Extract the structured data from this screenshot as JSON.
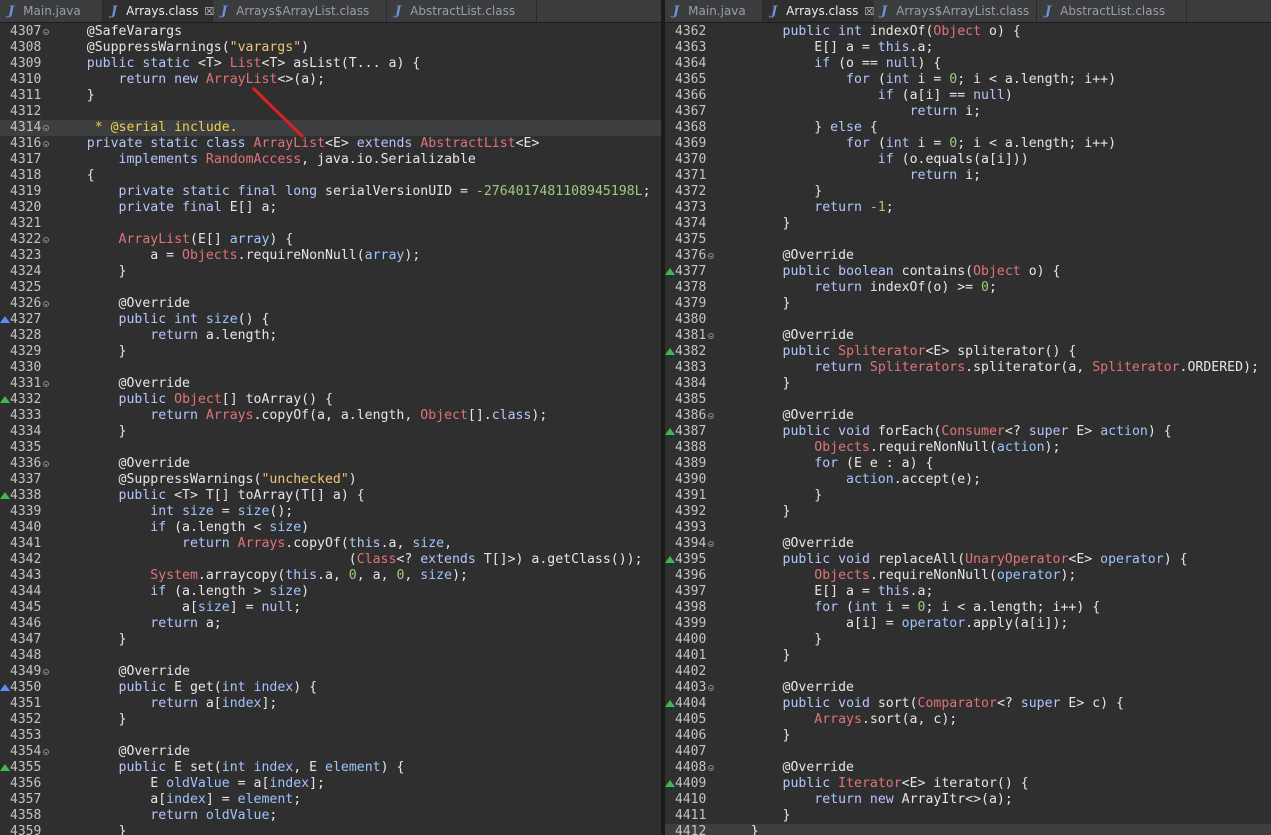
{
  "left_tabs": [
    {
      "label": "Main.java",
      "active": false,
      "closable": false
    },
    {
      "label": "Arrays.class",
      "active": true,
      "closable": true
    },
    {
      "label": "Arrays$ArrayList.class",
      "active": false,
      "closable": false
    },
    {
      "label": "AbstractList.class",
      "active": false,
      "closable": false
    }
  ],
  "right_tabs": [
    {
      "label": "Main.java",
      "active": false,
      "closable": false
    },
    {
      "label": "Arrays.class",
      "active": true,
      "closable": true
    },
    {
      "label": "Arrays$ArrayList.class",
      "active": false,
      "closable": false
    },
    {
      "label": "AbstractList.class",
      "active": false,
      "closable": false
    }
  ],
  "tab_icon": "J",
  "close_glyph": "☒",
  "colors": {
    "keyword": "#b4c6ff",
    "type": "#e0737a",
    "string": "#f0c674",
    "number": "#9ccc7a",
    "comment": "#f0d04b",
    "annotation_arrow": "#e0201f"
  },
  "left_lines": [
    {
      "n": "4307",
      "fold": true,
      "mark": "",
      "code": "    @SafeVarargs"
    },
    {
      "n": "4308",
      "fold": false,
      "mark": "",
      "code": "    @SuppressWarnings(\"varargs\")"
    },
    {
      "n": "4309",
      "fold": false,
      "mark": "",
      "code": "    public static <T> List<T> asList(T... a) {"
    },
    {
      "n": "4310",
      "fold": false,
      "mark": "",
      "code": "        return new ArrayList<>(a);"
    },
    {
      "n": "4311",
      "fold": false,
      "mark": "",
      "code": "    }"
    },
    {
      "n": "4312",
      "fold": false,
      "mark": "",
      "code": ""
    },
    {
      "n": "4314",
      "fold": true,
      "mark": "",
      "code": "     * @serial include.",
      "current": true
    },
    {
      "n": "4316",
      "fold": true,
      "mark": "",
      "code": "    private static class ArrayList<E> extends AbstractList<E>"
    },
    {
      "n": "4317",
      "fold": false,
      "mark": "",
      "code": "        implements RandomAccess, java.io.Serializable"
    },
    {
      "n": "4318",
      "fold": false,
      "mark": "",
      "code": "    {"
    },
    {
      "n": "4319",
      "fold": false,
      "mark": "",
      "code": "        private static final long serialVersionUID = -2764017481108945198L;"
    },
    {
      "n": "4320",
      "fold": false,
      "mark": "",
      "code": "        private final E[] a;"
    },
    {
      "n": "4321",
      "fold": false,
      "mark": "",
      "code": ""
    },
    {
      "n": "4322",
      "fold": true,
      "mark": "",
      "code": "        ArrayList(E[] array) {"
    },
    {
      "n": "4323",
      "fold": false,
      "mark": "",
      "code": "            a = Objects.requireNonNull(array);"
    },
    {
      "n": "4324",
      "fold": false,
      "mark": "",
      "code": "        }"
    },
    {
      "n": "4325",
      "fold": false,
      "mark": "",
      "code": ""
    },
    {
      "n": "4326",
      "fold": true,
      "mark": "",
      "code": "        @Override"
    },
    {
      "n": "4327",
      "fold": false,
      "mark": "blue",
      "code": "        public int size() {"
    },
    {
      "n": "4328",
      "fold": false,
      "mark": "",
      "code": "            return a.length;"
    },
    {
      "n": "4329",
      "fold": false,
      "mark": "",
      "code": "        }"
    },
    {
      "n": "4330",
      "fold": false,
      "mark": "",
      "code": ""
    },
    {
      "n": "4331",
      "fold": true,
      "mark": "",
      "code": "        @Override"
    },
    {
      "n": "4332",
      "fold": false,
      "mark": "green",
      "code": "        public Object[] toArray() {"
    },
    {
      "n": "4333",
      "fold": false,
      "mark": "",
      "code": "            return Arrays.copyOf(a, a.length, Object[].class);"
    },
    {
      "n": "4334",
      "fold": false,
      "mark": "",
      "code": "        }"
    },
    {
      "n": "4335",
      "fold": false,
      "mark": "",
      "code": ""
    },
    {
      "n": "4336",
      "fold": true,
      "mark": "",
      "code": "        @Override"
    },
    {
      "n": "4337",
      "fold": false,
      "mark": "",
      "code": "        @SuppressWarnings(\"unchecked\")"
    },
    {
      "n": "4338",
      "fold": false,
      "mark": "green",
      "code": "        public <T> T[] toArray(T[] a) {"
    },
    {
      "n": "4339",
      "fold": false,
      "mark": "",
      "code": "            int size = size();"
    },
    {
      "n": "4340",
      "fold": false,
      "mark": "",
      "code": "            if (a.length < size)"
    },
    {
      "n": "4341",
      "fold": false,
      "mark": "",
      "code": "                return Arrays.copyOf(this.a, size,"
    },
    {
      "n": "4342",
      "fold": false,
      "mark": "",
      "code": "                                     (Class<? extends T[]>) a.getClass());"
    },
    {
      "n": "4343",
      "fold": false,
      "mark": "",
      "code": "            System.arraycopy(this.a, 0, a, 0, size);"
    },
    {
      "n": "4344",
      "fold": false,
      "mark": "",
      "code": "            if (a.length > size)"
    },
    {
      "n": "4345",
      "fold": false,
      "mark": "",
      "code": "                a[size] = null;"
    },
    {
      "n": "4346",
      "fold": false,
      "mark": "",
      "code": "            return a;"
    },
    {
      "n": "4347",
      "fold": false,
      "mark": "",
      "code": "        }"
    },
    {
      "n": "4348",
      "fold": false,
      "mark": "",
      "code": ""
    },
    {
      "n": "4349",
      "fold": true,
      "mark": "",
      "code": "        @Override"
    },
    {
      "n": "4350",
      "fold": false,
      "mark": "blue",
      "code": "        public E get(int index) {"
    },
    {
      "n": "4351",
      "fold": false,
      "mark": "",
      "code": "            return a[index];"
    },
    {
      "n": "4352",
      "fold": false,
      "mark": "",
      "code": "        }"
    },
    {
      "n": "4353",
      "fold": false,
      "mark": "",
      "code": ""
    },
    {
      "n": "4354",
      "fold": true,
      "mark": "",
      "code": "        @Override"
    },
    {
      "n": "4355",
      "fold": false,
      "mark": "green",
      "code": "        public E set(int index, E element) {"
    },
    {
      "n": "4356",
      "fold": false,
      "mark": "",
      "code": "            E oldValue = a[index];"
    },
    {
      "n": "4357",
      "fold": false,
      "mark": "",
      "code": "            a[index] = element;"
    },
    {
      "n": "4358",
      "fold": false,
      "mark": "",
      "code": "            return oldValue;"
    },
    {
      "n": "4359",
      "fold": false,
      "mark": "",
      "code": "        }"
    }
  ],
  "right_lines": [
    {
      "n": "4362",
      "fold": false,
      "mark": "",
      "code": "        public int indexOf(Object o) {"
    },
    {
      "n": "4363",
      "fold": false,
      "mark": "",
      "code": "            E[] a = this.a;"
    },
    {
      "n": "4364",
      "fold": false,
      "mark": "",
      "code": "            if (o == null) {"
    },
    {
      "n": "4365",
      "fold": false,
      "mark": "",
      "code": "                for (int i = 0; i < a.length; i++)"
    },
    {
      "n": "4366",
      "fold": false,
      "mark": "",
      "code": "                    if (a[i] == null)"
    },
    {
      "n": "4367",
      "fold": false,
      "mark": "",
      "code": "                        return i;"
    },
    {
      "n": "4368",
      "fold": false,
      "mark": "",
      "code": "            } else {"
    },
    {
      "n": "4369",
      "fold": false,
      "mark": "",
      "code": "                for (int i = 0; i < a.length; i++)"
    },
    {
      "n": "4370",
      "fold": false,
      "mark": "",
      "code": "                    if (o.equals(a[i]))"
    },
    {
      "n": "4371",
      "fold": false,
      "mark": "",
      "code": "                        return i;"
    },
    {
      "n": "4372",
      "fold": false,
      "mark": "",
      "code": "            }"
    },
    {
      "n": "4373",
      "fold": false,
      "mark": "",
      "code": "            return -1;"
    },
    {
      "n": "4374",
      "fold": false,
      "mark": "",
      "code": "        }"
    },
    {
      "n": "4375",
      "fold": false,
      "mark": "",
      "code": ""
    },
    {
      "n": "4376",
      "fold": true,
      "mark": "",
      "code": "        @Override"
    },
    {
      "n": "4377",
      "fold": false,
      "mark": "green",
      "code": "        public boolean contains(Object o) {"
    },
    {
      "n": "4378",
      "fold": false,
      "mark": "",
      "code": "            return indexOf(o) >= 0;"
    },
    {
      "n": "4379",
      "fold": false,
      "mark": "",
      "code": "        }"
    },
    {
      "n": "4380",
      "fold": false,
      "mark": "",
      "code": ""
    },
    {
      "n": "4381",
      "fold": true,
      "mark": "",
      "code": "        @Override"
    },
    {
      "n": "4382",
      "fold": false,
      "mark": "green",
      "code": "        public Spliterator<E> spliterator() {"
    },
    {
      "n": "4383",
      "fold": false,
      "mark": "",
      "code": "            return Spliterators.spliterator(a, Spliterator.ORDERED);"
    },
    {
      "n": "4384",
      "fold": false,
      "mark": "",
      "code": "        }"
    },
    {
      "n": "4385",
      "fold": false,
      "mark": "",
      "code": ""
    },
    {
      "n": "4386",
      "fold": true,
      "mark": "",
      "code": "        @Override"
    },
    {
      "n": "4387",
      "fold": false,
      "mark": "green",
      "code": "        public void forEach(Consumer<? super E> action) {"
    },
    {
      "n": "4388",
      "fold": false,
      "mark": "",
      "code": "            Objects.requireNonNull(action);"
    },
    {
      "n": "4389",
      "fold": false,
      "mark": "",
      "code": "            for (E e : a) {"
    },
    {
      "n": "4390",
      "fold": false,
      "mark": "",
      "code": "                action.accept(e);"
    },
    {
      "n": "4391",
      "fold": false,
      "mark": "",
      "code": "            }"
    },
    {
      "n": "4392",
      "fold": false,
      "mark": "",
      "code": "        }"
    },
    {
      "n": "4393",
      "fold": false,
      "mark": "",
      "code": ""
    },
    {
      "n": "4394",
      "fold": true,
      "mark": "",
      "code": "        @Override"
    },
    {
      "n": "4395",
      "fold": false,
      "mark": "green",
      "code": "        public void replaceAll(UnaryOperator<E> operator) {"
    },
    {
      "n": "4396",
      "fold": false,
      "mark": "",
      "code": "            Objects.requireNonNull(operator);"
    },
    {
      "n": "4397",
      "fold": false,
      "mark": "",
      "code": "            E[] a = this.a;"
    },
    {
      "n": "4398",
      "fold": false,
      "mark": "",
      "code": "            for (int i = 0; i < a.length; i++) {"
    },
    {
      "n": "4399",
      "fold": false,
      "mark": "",
      "code": "                a[i] = operator.apply(a[i]);"
    },
    {
      "n": "4400",
      "fold": false,
      "mark": "",
      "code": "            }"
    },
    {
      "n": "4401",
      "fold": false,
      "mark": "",
      "code": "        }"
    },
    {
      "n": "4402",
      "fold": false,
      "mark": "",
      "code": ""
    },
    {
      "n": "4403",
      "fold": true,
      "mark": "",
      "code": "        @Override"
    },
    {
      "n": "4404",
      "fold": false,
      "mark": "green",
      "code": "        public void sort(Comparator<? super E> c) {"
    },
    {
      "n": "4405",
      "fold": false,
      "mark": "",
      "code": "            Arrays.sort(a, c);"
    },
    {
      "n": "4406",
      "fold": false,
      "mark": "",
      "code": "        }"
    },
    {
      "n": "4407",
      "fold": false,
      "mark": "",
      "code": ""
    },
    {
      "n": "4408",
      "fold": true,
      "mark": "",
      "code": "        @Override"
    },
    {
      "n": "4409",
      "fold": false,
      "mark": "green",
      "code": "        public Iterator<E> iterator() {"
    },
    {
      "n": "4410",
      "fold": false,
      "mark": "",
      "code": "            return new ArrayItr<>(a);"
    },
    {
      "n": "4411",
      "fold": false,
      "mark": "",
      "code": "        }"
    },
    {
      "n": "4412",
      "fold": false,
      "mark": "",
      "code": "    }",
      "current": true
    }
  ]
}
